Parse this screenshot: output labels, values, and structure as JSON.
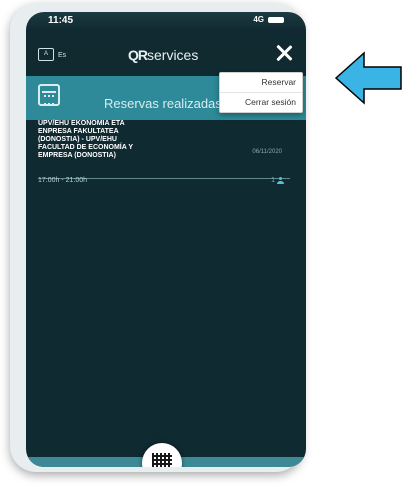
{
  "status": {
    "time": "11:45",
    "signal": "4G"
  },
  "header": {
    "language": "Es",
    "logo_prefix": "QR",
    "logo_suffix": "services"
  },
  "banner": {
    "title": "Reservas realizadas"
  },
  "menu": {
    "items": [
      "Reservar",
      "Cerrar sesión"
    ]
  },
  "reservation": {
    "name_lines": [
      "UPV/EHU EKONOMIA ETA",
      "ENPRESA FAKULTATEA",
      "(DONOSTIA) - UPV/EHU",
      "FACULTAD DE ECONOMÍA Y",
      "EMPRESA (DONOSTIA)"
    ],
    "date": "06/11/2020",
    "time": "17:00h - 21:00h",
    "count": "1"
  },
  "colors": {
    "background": "#0f2a30",
    "banner": "#2e8a98",
    "arrow": "#3ab4e5"
  },
  "icons": {
    "language": "language-icon",
    "close": "close-icon",
    "calendar": "calendar-icon",
    "person": "person-icon",
    "qr": "qr-code-icon",
    "arrow": "left-arrow-icon"
  }
}
